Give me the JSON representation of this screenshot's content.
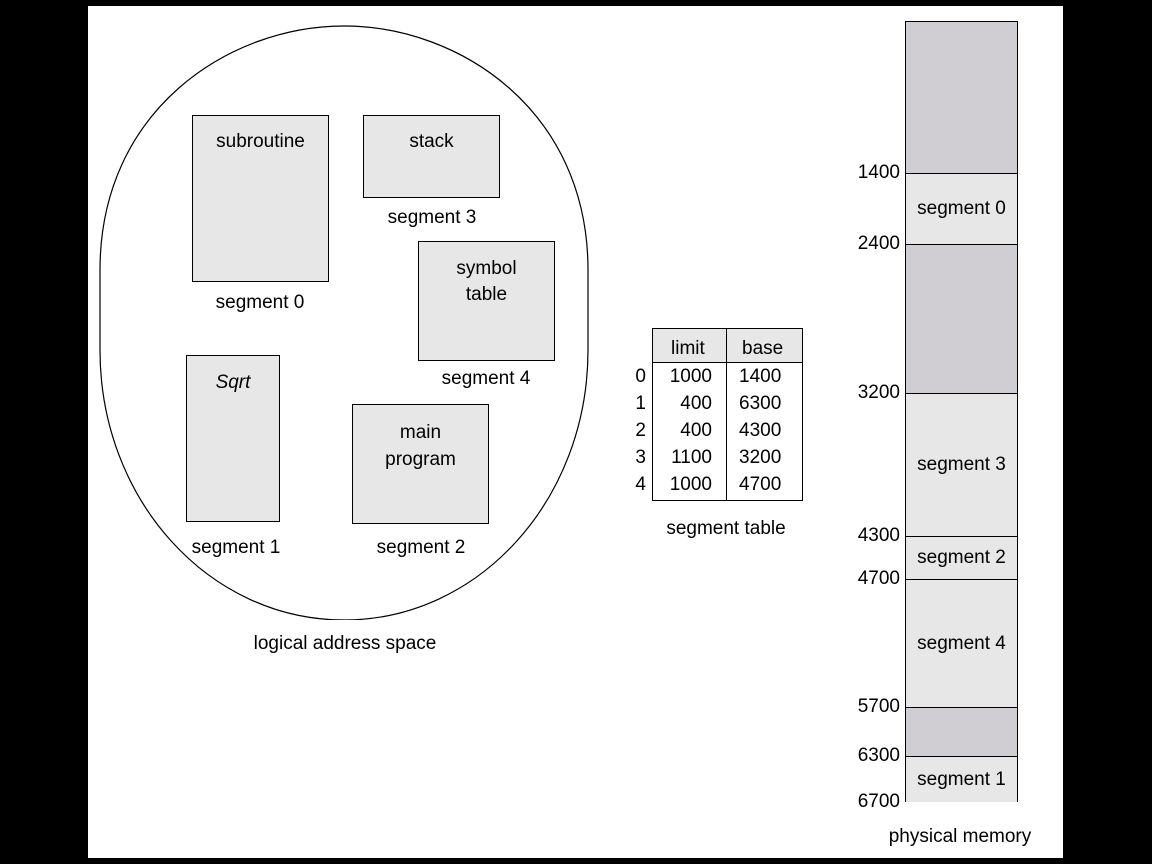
{
  "logical": {
    "caption": "logical address space",
    "segments": [
      {
        "name": "subroutine",
        "label": "segment 0"
      },
      {
        "name": "Sqrt",
        "label": "segment 1"
      },
      {
        "name_lines": [
          "main",
          "program"
        ],
        "label": "segment 2"
      },
      {
        "name": "stack",
        "label": "segment 3"
      },
      {
        "name_lines": [
          "symbol",
          "table"
        ],
        "label": "segment 4"
      }
    ]
  },
  "segment_table": {
    "caption": "segment table",
    "headers": [
      "limit",
      "base"
    ],
    "rows": [
      {
        "index": "0",
        "limit": "1000",
        "base": "1400"
      },
      {
        "index": "1",
        "limit": "400",
        "base": "6300"
      },
      {
        "index": "2",
        "limit": "400",
        "base": "4300"
      },
      {
        "index": "3",
        "limit": "1100",
        "base": "3200"
      },
      {
        "index": "4",
        "limit": "1000",
        "base": "4700"
      }
    ]
  },
  "physical": {
    "caption": "physical memory",
    "start": 0,
    "end": 6700,
    "blocks": [
      {
        "from": 0,
        "to": 1400,
        "label": "",
        "kind": "free"
      },
      {
        "from": 1400,
        "to": 2400,
        "label": "segment 0",
        "kind": "used"
      },
      {
        "from": 2400,
        "to": 3200,
        "label": "",
        "kind": "free"
      },
      {
        "from": 3200,
        "to": 4300,
        "label": "segment 3",
        "kind": "used"
      },
      {
        "from": 4300,
        "to": 4700,
        "label": "segment 2",
        "kind": "used"
      },
      {
        "from": 4700,
        "to": 5700,
        "label": "segment 4",
        "kind": "used"
      },
      {
        "from": 5700,
        "to": 6300,
        "label": "",
        "kind": "free"
      },
      {
        "from": 6300,
        "to": 6700,
        "label": "segment 1",
        "kind": "used"
      }
    ],
    "address_labels": [
      "1400",
      "2400",
      "3200",
      "4300",
      "4700",
      "5700",
      "6300",
      "6700"
    ]
  },
  "colors": {
    "used": "#e7e7e7",
    "free": "#d0ced2",
    "border": "#000000",
    "background": "#ffffff"
  }
}
